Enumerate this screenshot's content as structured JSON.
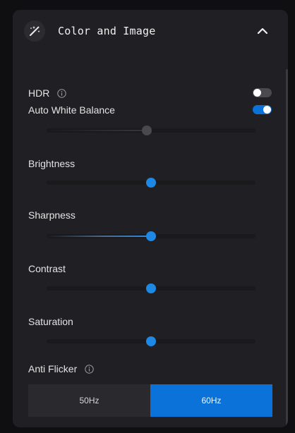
{
  "section": {
    "title": "Color and Image",
    "icon": "magic-wand-icon",
    "collapse_icon": "chevron-up-icon"
  },
  "hdr": {
    "label": "HDR",
    "icon": "info-icon",
    "enabled": false
  },
  "auto_white_balance": {
    "label": "Auto White Balance",
    "enabled": true,
    "slider_value": 0.48,
    "slider_disabled": true
  },
  "brightness": {
    "label": "Brightness",
    "value": 0.5
  },
  "sharpness": {
    "label": "Sharpness",
    "value": 0.5
  },
  "contrast": {
    "label": "Contrast",
    "value": 0.5
  },
  "saturation": {
    "label": "Saturation",
    "value": 0.5
  },
  "anti_flicker": {
    "label": "Anti Flicker",
    "icon": "info-icon",
    "options": [
      "50Hz",
      "60Hz"
    ],
    "selected": "60Hz"
  },
  "colors": {
    "accent": "#0a72d8",
    "thumb": "#1e88e5",
    "panel": "#202024",
    "background": "#0f0f11"
  }
}
